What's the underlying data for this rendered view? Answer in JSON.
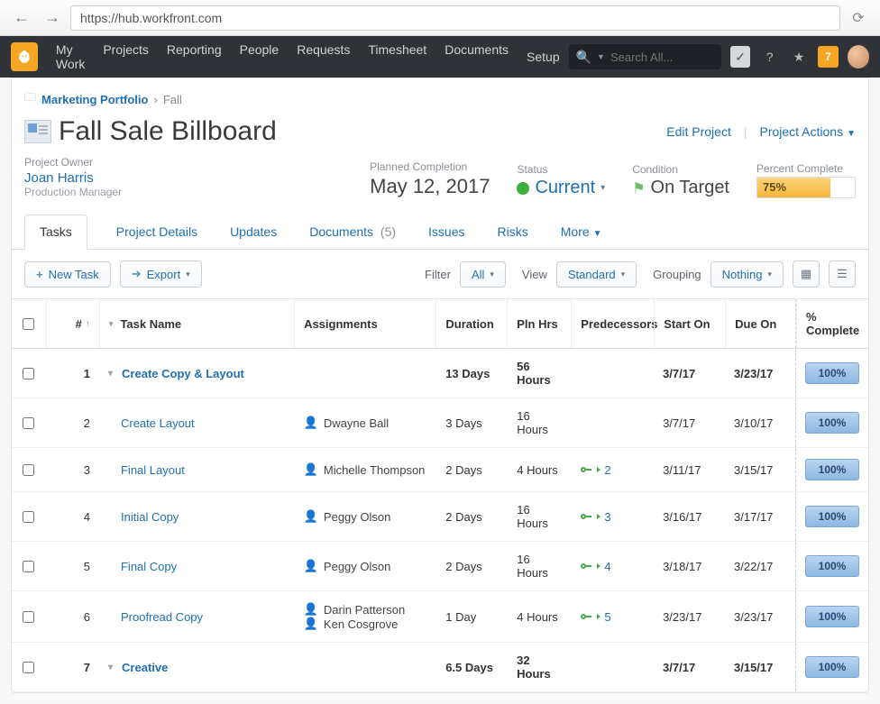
{
  "browser": {
    "url": "https://hub.workfront.com"
  },
  "topnav": {
    "items": [
      "My Work",
      "Projects",
      "Reporting",
      "People",
      "Requests",
      "Timesheet",
      "Documents"
    ],
    "setup": "Setup",
    "search_placeholder": "Search All...",
    "notif_count": "7"
  },
  "breadcrumb": {
    "parent": "Marketing Portfolio",
    "current": "Fall"
  },
  "project": {
    "title": "Fall Sale Billboard",
    "edit": "Edit Project",
    "actions": "Project Actions",
    "owner_label": "Project Owner",
    "owner_name": "Joan Harris",
    "owner_role": "Production Manager",
    "planned_label": "Planned Completion",
    "planned_date": "May 12, 2017",
    "status_label": "Status",
    "status_value": "Current",
    "condition_label": "Condition",
    "condition_value": "On Target",
    "pct_label": "Percent Complete",
    "pct_value": "75%"
  },
  "tabs": {
    "tasks": "Tasks",
    "details": "Project Details",
    "updates": "Updates",
    "documents": "Documents",
    "documents_count": "(5)",
    "issues": "Issues",
    "risks": "Risks",
    "more": "More"
  },
  "toolbar": {
    "new_task": "New Task",
    "export": "Export",
    "filter_label": "Filter",
    "filter_value": "All",
    "view_label": "View",
    "view_value": "Standard",
    "grouping_label": "Grouping",
    "grouping_value": "Nothing"
  },
  "columns": {
    "num": "#",
    "task_name": "Task Name",
    "assignments": "Assignments",
    "duration": "Duration",
    "pln_hrs": "Pln Hrs",
    "predecessors": "Predecessors",
    "start_on": "Start On",
    "due_on": "Due On",
    "pct_complete": "% Complete"
  },
  "rows": [
    {
      "num": "1",
      "bold": true,
      "expandable": true,
      "name": "Create Copy & Layout",
      "assignees": [],
      "duration": "13 Days",
      "pln": "56 Hours",
      "pred": "",
      "start": "3/7/17",
      "due": "3/23/17",
      "pct": "100%"
    },
    {
      "num": "2",
      "bold": false,
      "name": "Create Layout",
      "assignees": [
        "Dwayne Ball"
      ],
      "duration": "3 Days",
      "pln": "16 Hours",
      "pred": "",
      "start": "3/7/17",
      "due": "3/10/17",
      "pct": "100%"
    },
    {
      "num": "3",
      "bold": false,
      "name": "Final Layout",
      "assignees": [
        "Michelle Thompson"
      ],
      "duration": "2 Days",
      "pln": "4 Hours",
      "pred": "2",
      "start": "3/11/17",
      "due": "3/15/17",
      "pct": "100%"
    },
    {
      "num": "4",
      "bold": false,
      "name": "Initial Copy",
      "assignees": [
        "Peggy Olson"
      ],
      "duration": "2 Days",
      "pln": "16 Hours",
      "pred": "3",
      "start": "3/16/17",
      "due": "3/17/17",
      "pct": "100%"
    },
    {
      "num": "5",
      "bold": false,
      "name": "Final Copy",
      "assignees": [
        "Peggy Olson"
      ],
      "duration": "2 Days",
      "pln": "16 Hours",
      "pred": "4",
      "start": "3/18/17",
      "due": "3/22/17",
      "pct": "100%"
    },
    {
      "num": "6",
      "bold": false,
      "name": "Proofread Copy",
      "assignees": [
        "Darin Patterson",
        "Ken Cosgrove"
      ],
      "duration": "1 Day",
      "pln": "4 Hours",
      "pred": "5",
      "start": "3/23/17",
      "due": "3/23/17",
      "pct": "100%"
    },
    {
      "num": "7",
      "bold": true,
      "expandable": true,
      "name": "Creative",
      "assignees": [],
      "duration": "6.5 Days",
      "pln": "32 Hours",
      "pred": "",
      "start": "3/7/17",
      "due": "3/15/17",
      "pct": "100%"
    }
  ]
}
